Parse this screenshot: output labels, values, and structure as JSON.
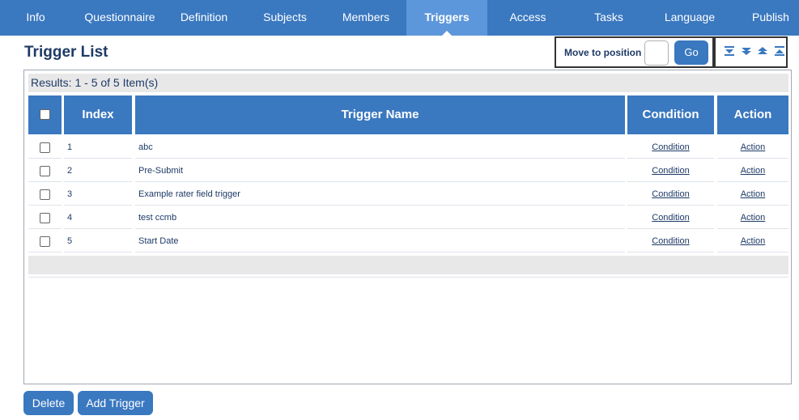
{
  "nav": {
    "tabs": [
      {
        "label": "Info"
      },
      {
        "label": "Questionnaire"
      },
      {
        "label": "Definition"
      },
      {
        "label": "Subjects"
      },
      {
        "label": "Members"
      },
      {
        "label": "Triggers",
        "active": true
      },
      {
        "label": "Access"
      },
      {
        "label": "Tasks"
      },
      {
        "label": "Language"
      },
      {
        "label": "Publish"
      }
    ]
  },
  "page": {
    "title": "Trigger List"
  },
  "move": {
    "label": "Move to position",
    "input_value": "",
    "go_label": "Go"
  },
  "arrows": [
    "move-top-icon",
    "move-down-icon",
    "move-up-icon",
    "move-bottom-icon"
  ],
  "results": {
    "text": "Results: 1 - 5 of 5 Item(s)"
  },
  "table": {
    "headers": {
      "index": "Index",
      "name": "Trigger Name",
      "condition": "Condition",
      "action": "Action"
    },
    "rows": [
      {
        "index": "1",
        "name": "abc",
        "condition": "Condition",
        "action": "Action"
      },
      {
        "index": "2",
        "name": "Pre-Submit",
        "condition": "Condition",
        "action": "Action"
      },
      {
        "index": "3",
        "name": "Example rater field trigger",
        "condition": "Condition",
        "action": "Action"
      },
      {
        "index": "4",
        "name": "test ccmb",
        "condition": "Condition",
        "action": "Action"
      },
      {
        "index": "5",
        "name": "Start Date",
        "condition": "Condition",
        "action": "Action"
      }
    ]
  },
  "buttons": {
    "delete": "Delete",
    "add_trigger": "Add Trigger"
  },
  "colors": {
    "primary": "#3a78c0",
    "active_tab": "#5d97db",
    "text": "#1e3a66"
  }
}
